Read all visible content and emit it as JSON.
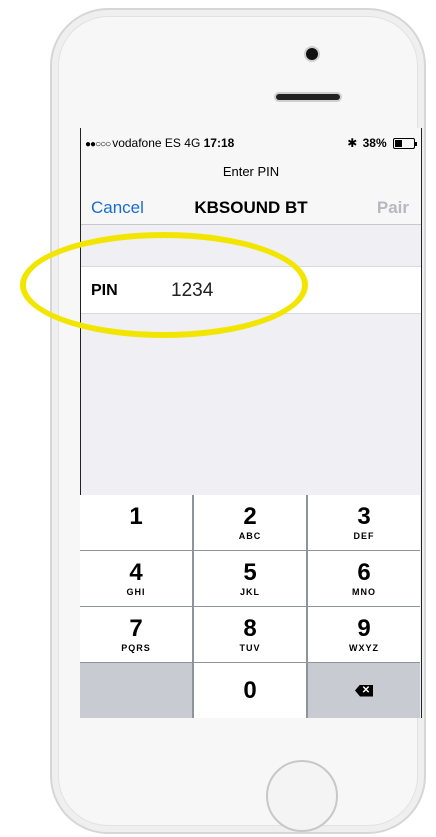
{
  "status_bar": {
    "signal": "●●○○○",
    "carrier": "vodafone ES",
    "network": "4G",
    "time": "17:18",
    "bluetooth_icon": "bluetooth-icon",
    "battery": "38%",
    "battery_level": 0.38
  },
  "header": {
    "prompt": "Enter PIN",
    "cancel_label": "Cancel",
    "title": "KBSOUND BT",
    "pair_label": "Pair"
  },
  "pin_field": {
    "label": "PIN",
    "value": "1234"
  },
  "keypad": {
    "keys": [
      {
        "digit": "1",
        "letters": ""
      },
      {
        "digit": "2",
        "letters": "ABC"
      },
      {
        "digit": "3",
        "letters": "DEF"
      },
      {
        "digit": "4",
        "letters": "GHI"
      },
      {
        "digit": "5",
        "letters": "JKL"
      },
      {
        "digit": "6",
        "letters": "MNO"
      },
      {
        "digit": "7",
        "letters": "PQRS"
      },
      {
        "digit": "8",
        "letters": "TUV"
      },
      {
        "digit": "9",
        "letters": "WXYZ"
      },
      {
        "digit": "0",
        "letters": ""
      }
    ],
    "delete_icon": "backspace-icon"
  },
  "colors": {
    "accent": "#1a6dce",
    "highlight": "#f2e600",
    "disabled": "#b8b8bd"
  }
}
